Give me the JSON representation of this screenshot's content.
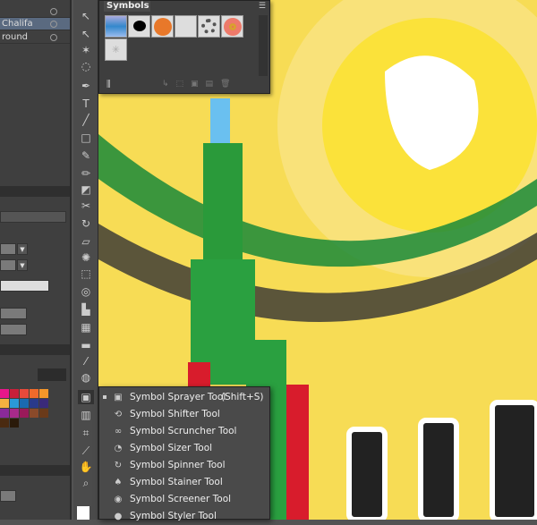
{
  "layers": {
    "rows": [
      {
        "name": ""
      },
      {
        "name": "Chalifa",
        "selected": true
      },
      {
        "name": "round"
      }
    ]
  },
  "symbols_panel": {
    "title": "Symbols",
    "swatches": [
      "blue-bar",
      "ink-splat",
      "orange-button",
      "corner-frame",
      "dotted-ring",
      "flower",
      "sparkle"
    ]
  },
  "flyout": {
    "items": [
      {
        "label": "Symbol Sprayer Tool",
        "shortcut": "(Shift+S)",
        "icon": "symbol-sprayer-icon",
        "checked": true
      },
      {
        "label": "Symbol Shifter Tool",
        "icon": "symbol-shifter-icon"
      },
      {
        "label": "Symbol Scruncher Tool",
        "icon": "symbol-scruncher-icon"
      },
      {
        "label": "Symbol Sizer Tool",
        "icon": "symbol-sizer-icon"
      },
      {
        "label": "Symbol Spinner Tool",
        "icon": "symbol-spinner-icon"
      },
      {
        "label": "Symbol Stainer Tool",
        "icon": "symbol-stainer-icon"
      },
      {
        "label": "Symbol Screener Tool",
        "icon": "symbol-screener-icon"
      },
      {
        "label": "Symbol Styler Tool",
        "icon": "symbol-styler-icon"
      }
    ]
  },
  "swatch_colors": [
    "#e8168a",
    "#c8203a",
    "#e84a3a",
    "#f06a2a",
    "#f5962a",
    "#f5b040",
    "#2a9ad8",
    "#1a6ab0",
    "#2a3a8a",
    "#3a2a7a",
    "#8a2a9a",
    "#a82a8a",
    "#9a1a5a",
    "#8a4a2a",
    "#6a3a1a",
    "#4a2a10",
    "#2a1a0a"
  ],
  "colors": {
    "canvas": "#f5d94a",
    "panel": "#3f3f3f",
    "selection": "#5a6a80"
  }
}
